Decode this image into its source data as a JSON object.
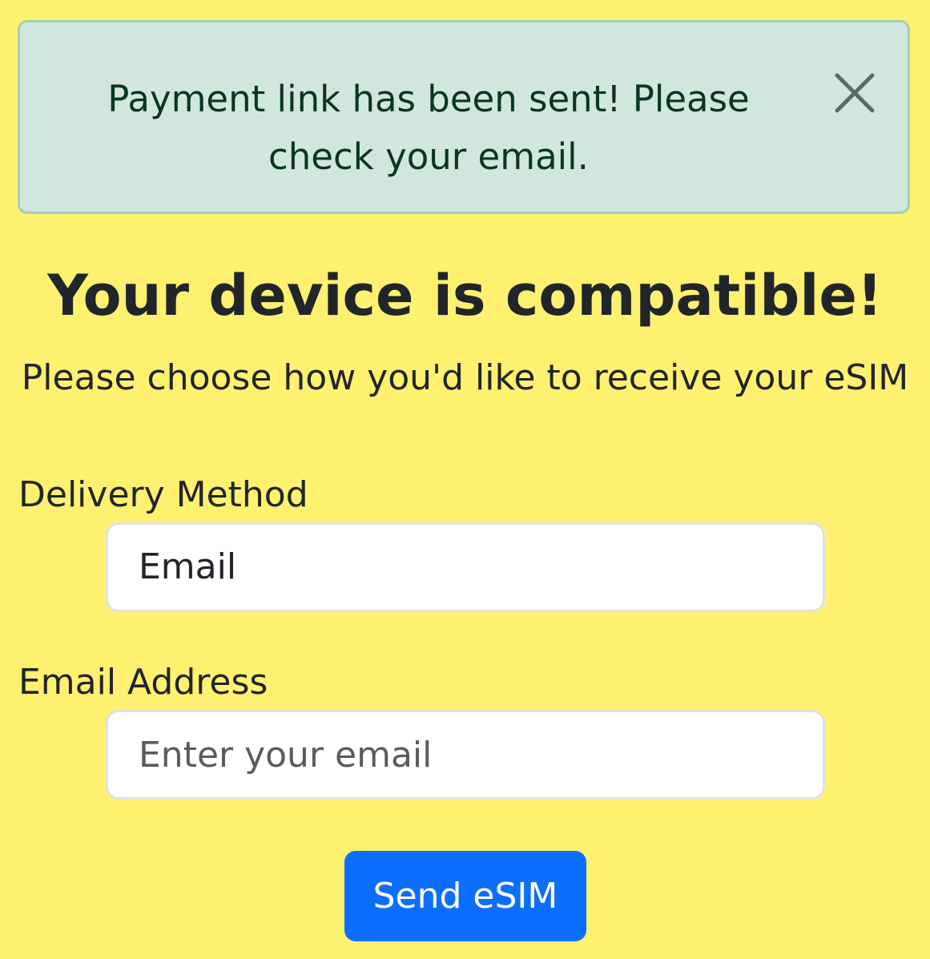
{
  "alert": {
    "message": "Payment link has been sent! Please check your email.",
    "close_icon": "close-icon"
  },
  "heading": "Your device is compatible!",
  "subheading": "Please choose how you'd like to receive your eSIM",
  "form": {
    "delivery_method": {
      "label": "Delivery Method",
      "selected_value": "Email"
    },
    "email_address": {
      "label": "Email Address",
      "value": "",
      "placeholder": "Enter your email"
    },
    "submit_label": "Send eSIM"
  },
  "colors": {
    "page_background": "#fff170",
    "alert_background": "#d1e7dd",
    "alert_border": "#a3cfbb",
    "alert_text": "#0a3622",
    "primary_button": "#0d6efd"
  }
}
